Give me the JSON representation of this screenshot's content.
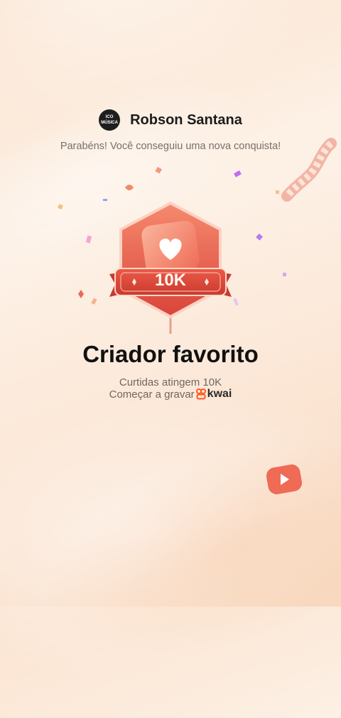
{
  "user": {
    "name": "Robson Santana",
    "avatar_text": "ICO MÚSICA"
  },
  "congrats_message": "Parabéns! Você conseguiu uma nova conquista!",
  "badge": {
    "value_label": "10K",
    "icon": "heart-icon"
  },
  "achievement": {
    "title": "Criador favorito",
    "description": "Curtidas atingem 10K",
    "cta_text": "Começar a gravar",
    "brand": "kwai"
  },
  "colors": {
    "accent": "#e0503f",
    "brand_orange": "#ff5a1f",
    "background": "#fdf1e6"
  }
}
